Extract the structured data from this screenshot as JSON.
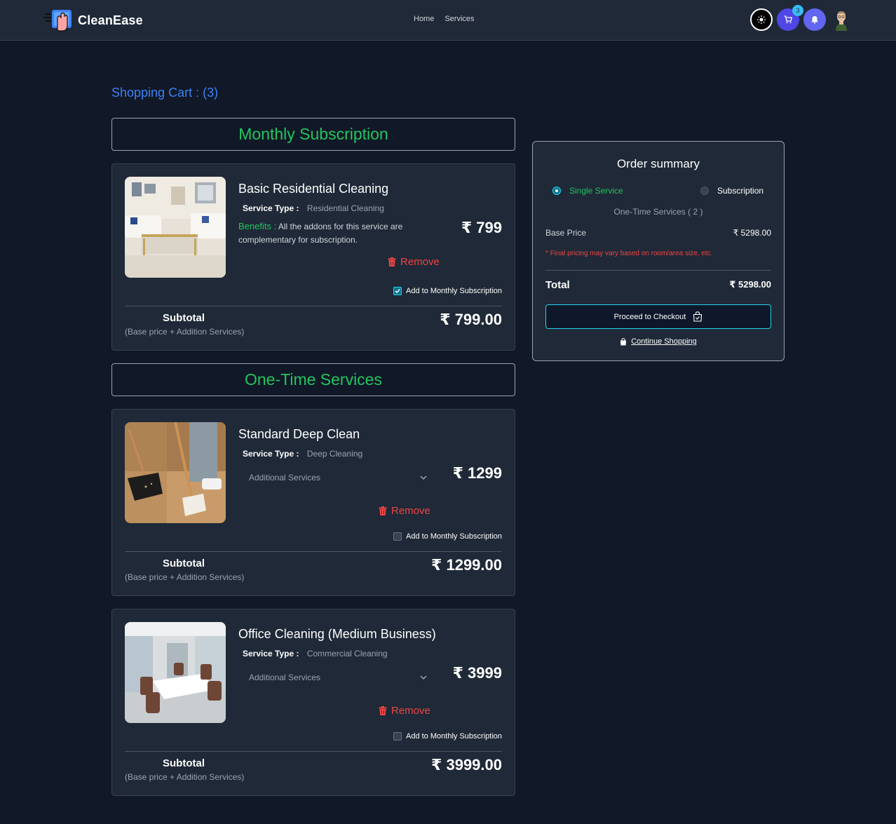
{
  "header": {
    "brand": "CleanEase",
    "nav": [
      "Home",
      "Services"
    ],
    "cart_count": "3"
  },
  "cart": {
    "title": "Shopping Cart : (3)"
  },
  "sections": {
    "monthly": "Monthly Subscription",
    "one_time": "One-Time Services"
  },
  "labels": {
    "service_type": "Service Type :",
    "benefits": "Benefits :",
    "remove": "Remove",
    "add_subscription": "Add to Monthly Subscription",
    "additional_services": "Additional Services",
    "subtotal": "Subtotal",
    "subtotal_note": "(Base price + Addition Services)"
  },
  "items": [
    {
      "name": "Basic Residential Cleaning",
      "service_type": "Residential Cleaning",
      "benefits_text": "All the addons for this service are complementary for subscription.",
      "price": "₹ 799",
      "subtotal": "₹ 799.00",
      "subscribed": true
    },
    {
      "name": "Standard Deep Clean",
      "service_type": "Deep Cleaning",
      "price": "₹ 1299",
      "subtotal": "₹ 1299.00",
      "subscribed": false
    },
    {
      "name": "Office Cleaning (Medium Business)",
      "service_type": "Commercial Cleaning",
      "price": "₹ 3999",
      "subtotal": "₹ 3999.00",
      "subscribed": false
    }
  ],
  "summary": {
    "title": "Order summary",
    "option_single": "Single Service",
    "option_subscription": "Subscription",
    "selected": "Single Service",
    "count_line": "One-Time Services ( 2 )",
    "base_price_label": "Base Price",
    "base_price": "₹ 5298.00",
    "note_star": "*",
    "note": "Final pricing may vary based on room/area size, etc.",
    "total_label": "Total",
    "total": "₹ 5298.00",
    "checkout": "Proceed to Checkout",
    "continue": "Continue Shopping"
  },
  "colors": {
    "background": "#111827",
    "card": "#1f2937",
    "accent_green": "#22c55e",
    "accent_blue": "#3b82f6",
    "danger": "#ef4444",
    "cyan": "#22d3ee"
  }
}
